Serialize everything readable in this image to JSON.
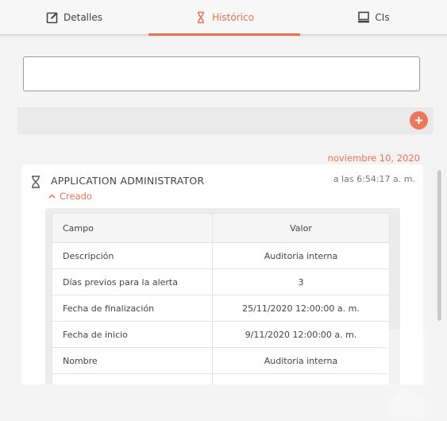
{
  "tabs": [
    {
      "label": "Detalles",
      "icon": "edit-icon"
    },
    {
      "label": "Histórico",
      "icon": "hourglass-icon",
      "active": true
    },
    {
      "label": "CIs",
      "icon": "computer-icon"
    }
  ],
  "comment": {
    "value": "",
    "placeholder": ""
  },
  "date_label": "noviembre 10, 2020",
  "entry": {
    "user": "APPLICATION ADMINISTRATOR",
    "time": "a las 6:54:17 a. m.",
    "action": "Creado",
    "table": {
      "headers": [
        "Campo",
        "Valor"
      ],
      "rows": [
        [
          "Descripción",
          "Auditoria interna"
        ],
        [
          "Días previos para la alerta",
          "3"
        ],
        [
          "Fecha de finalización",
          "25/11/2020 12:00:00 a. m."
        ],
        [
          "Fecha de inicio",
          "9/11/2020 12:00:00 a. m."
        ],
        [
          "Nombre",
          "Auditoria interna"
        ]
      ]
    }
  },
  "colors": {
    "accent": "#ef6f52",
    "text": "#444444"
  }
}
